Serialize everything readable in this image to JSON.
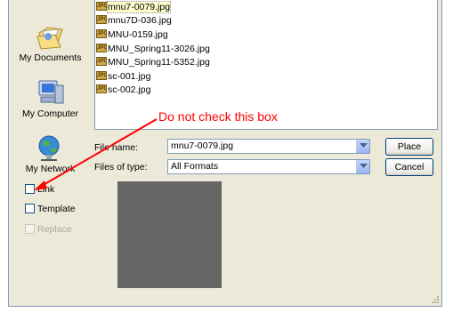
{
  "places": [
    {
      "label": "My Documents",
      "icon": "my-documents-icon"
    },
    {
      "label": "My Computer",
      "icon": "my-computer-icon"
    },
    {
      "label": "My Network",
      "icon": "my-network-icon"
    }
  ],
  "files": [
    {
      "name": "mnu7-0079.jpg",
      "selected": true
    },
    {
      "name": "mnu7D-036.jpg"
    },
    {
      "name": "MNU-0159.jpg"
    },
    {
      "name": "MNU_Spring11-3026.jpg"
    },
    {
      "name": "MNU_Spring11-5352.jpg"
    },
    {
      "name": "sc-001.jpg"
    },
    {
      "name": "sc-002.jpg"
    }
  ],
  "file_icon_text": "JPG",
  "form": {
    "file_name_label": "File name:",
    "file_name_value": "mnu7-0079.jpg",
    "file_type_label": "Files of type:",
    "file_type_value": "All Formats",
    "place_button": "Place",
    "cancel_button": "Cancel"
  },
  "options": {
    "link": "Link",
    "template": "Template",
    "replace": "Replace"
  },
  "annotation": {
    "text": "Do not check this box",
    "color": "#ff0000"
  },
  "colors": {
    "dialog_bg": "#ece9d8",
    "border": "#7f9db9",
    "preview": "#666666"
  }
}
